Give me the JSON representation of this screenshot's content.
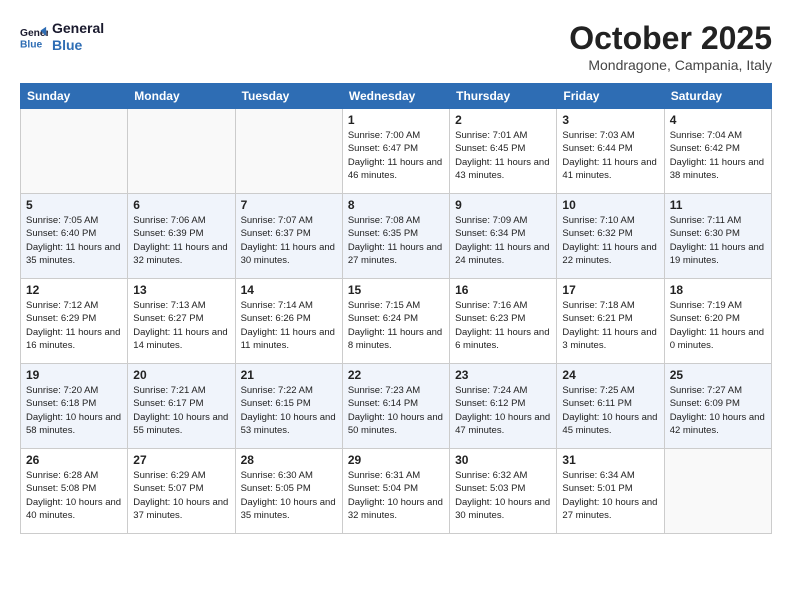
{
  "header": {
    "logo_line1": "General",
    "logo_line2": "Blue",
    "month": "October 2025",
    "location": "Mondragone, Campania, Italy"
  },
  "weekdays": [
    "Sunday",
    "Monday",
    "Tuesday",
    "Wednesday",
    "Thursday",
    "Friday",
    "Saturday"
  ],
  "weeks": [
    [
      {
        "day": "",
        "info": ""
      },
      {
        "day": "",
        "info": ""
      },
      {
        "day": "",
        "info": ""
      },
      {
        "day": "1",
        "info": "Sunrise: 7:00 AM\nSunset: 6:47 PM\nDaylight: 11 hours\nand 46 minutes."
      },
      {
        "day": "2",
        "info": "Sunrise: 7:01 AM\nSunset: 6:45 PM\nDaylight: 11 hours\nand 43 minutes."
      },
      {
        "day": "3",
        "info": "Sunrise: 7:03 AM\nSunset: 6:44 PM\nDaylight: 11 hours\nand 41 minutes."
      },
      {
        "day": "4",
        "info": "Sunrise: 7:04 AM\nSunset: 6:42 PM\nDaylight: 11 hours\nand 38 minutes."
      }
    ],
    [
      {
        "day": "5",
        "info": "Sunrise: 7:05 AM\nSunset: 6:40 PM\nDaylight: 11 hours\nand 35 minutes."
      },
      {
        "day": "6",
        "info": "Sunrise: 7:06 AM\nSunset: 6:39 PM\nDaylight: 11 hours\nand 32 minutes."
      },
      {
        "day": "7",
        "info": "Sunrise: 7:07 AM\nSunset: 6:37 PM\nDaylight: 11 hours\nand 30 minutes."
      },
      {
        "day": "8",
        "info": "Sunrise: 7:08 AM\nSunset: 6:35 PM\nDaylight: 11 hours\nand 27 minutes."
      },
      {
        "day": "9",
        "info": "Sunrise: 7:09 AM\nSunset: 6:34 PM\nDaylight: 11 hours\nand 24 minutes."
      },
      {
        "day": "10",
        "info": "Sunrise: 7:10 AM\nSunset: 6:32 PM\nDaylight: 11 hours\nand 22 minutes."
      },
      {
        "day": "11",
        "info": "Sunrise: 7:11 AM\nSunset: 6:30 PM\nDaylight: 11 hours\nand 19 minutes."
      }
    ],
    [
      {
        "day": "12",
        "info": "Sunrise: 7:12 AM\nSunset: 6:29 PM\nDaylight: 11 hours\nand 16 minutes."
      },
      {
        "day": "13",
        "info": "Sunrise: 7:13 AM\nSunset: 6:27 PM\nDaylight: 11 hours\nand 14 minutes."
      },
      {
        "day": "14",
        "info": "Sunrise: 7:14 AM\nSunset: 6:26 PM\nDaylight: 11 hours\nand 11 minutes."
      },
      {
        "day": "15",
        "info": "Sunrise: 7:15 AM\nSunset: 6:24 PM\nDaylight: 11 hours\nand 8 minutes."
      },
      {
        "day": "16",
        "info": "Sunrise: 7:16 AM\nSunset: 6:23 PM\nDaylight: 11 hours\nand 6 minutes."
      },
      {
        "day": "17",
        "info": "Sunrise: 7:18 AM\nSunset: 6:21 PM\nDaylight: 11 hours\nand 3 minutes."
      },
      {
        "day": "18",
        "info": "Sunrise: 7:19 AM\nSunset: 6:20 PM\nDaylight: 11 hours\nand 0 minutes."
      }
    ],
    [
      {
        "day": "19",
        "info": "Sunrise: 7:20 AM\nSunset: 6:18 PM\nDaylight: 10 hours\nand 58 minutes."
      },
      {
        "day": "20",
        "info": "Sunrise: 7:21 AM\nSunset: 6:17 PM\nDaylight: 10 hours\nand 55 minutes."
      },
      {
        "day": "21",
        "info": "Sunrise: 7:22 AM\nSunset: 6:15 PM\nDaylight: 10 hours\nand 53 minutes."
      },
      {
        "day": "22",
        "info": "Sunrise: 7:23 AM\nSunset: 6:14 PM\nDaylight: 10 hours\nand 50 minutes."
      },
      {
        "day": "23",
        "info": "Sunrise: 7:24 AM\nSunset: 6:12 PM\nDaylight: 10 hours\nand 47 minutes."
      },
      {
        "day": "24",
        "info": "Sunrise: 7:25 AM\nSunset: 6:11 PM\nDaylight: 10 hours\nand 45 minutes."
      },
      {
        "day": "25",
        "info": "Sunrise: 7:27 AM\nSunset: 6:09 PM\nDaylight: 10 hours\nand 42 minutes."
      }
    ],
    [
      {
        "day": "26",
        "info": "Sunrise: 6:28 AM\nSunset: 5:08 PM\nDaylight: 10 hours\nand 40 minutes."
      },
      {
        "day": "27",
        "info": "Sunrise: 6:29 AM\nSunset: 5:07 PM\nDaylight: 10 hours\nand 37 minutes."
      },
      {
        "day": "28",
        "info": "Sunrise: 6:30 AM\nSunset: 5:05 PM\nDaylight: 10 hours\nand 35 minutes."
      },
      {
        "day": "29",
        "info": "Sunrise: 6:31 AM\nSunset: 5:04 PM\nDaylight: 10 hours\nand 32 minutes."
      },
      {
        "day": "30",
        "info": "Sunrise: 6:32 AM\nSunset: 5:03 PM\nDaylight: 10 hours\nand 30 minutes."
      },
      {
        "day": "31",
        "info": "Sunrise: 6:34 AM\nSunset: 5:01 PM\nDaylight: 10 hours\nand 27 minutes."
      },
      {
        "day": "",
        "info": ""
      }
    ]
  ]
}
